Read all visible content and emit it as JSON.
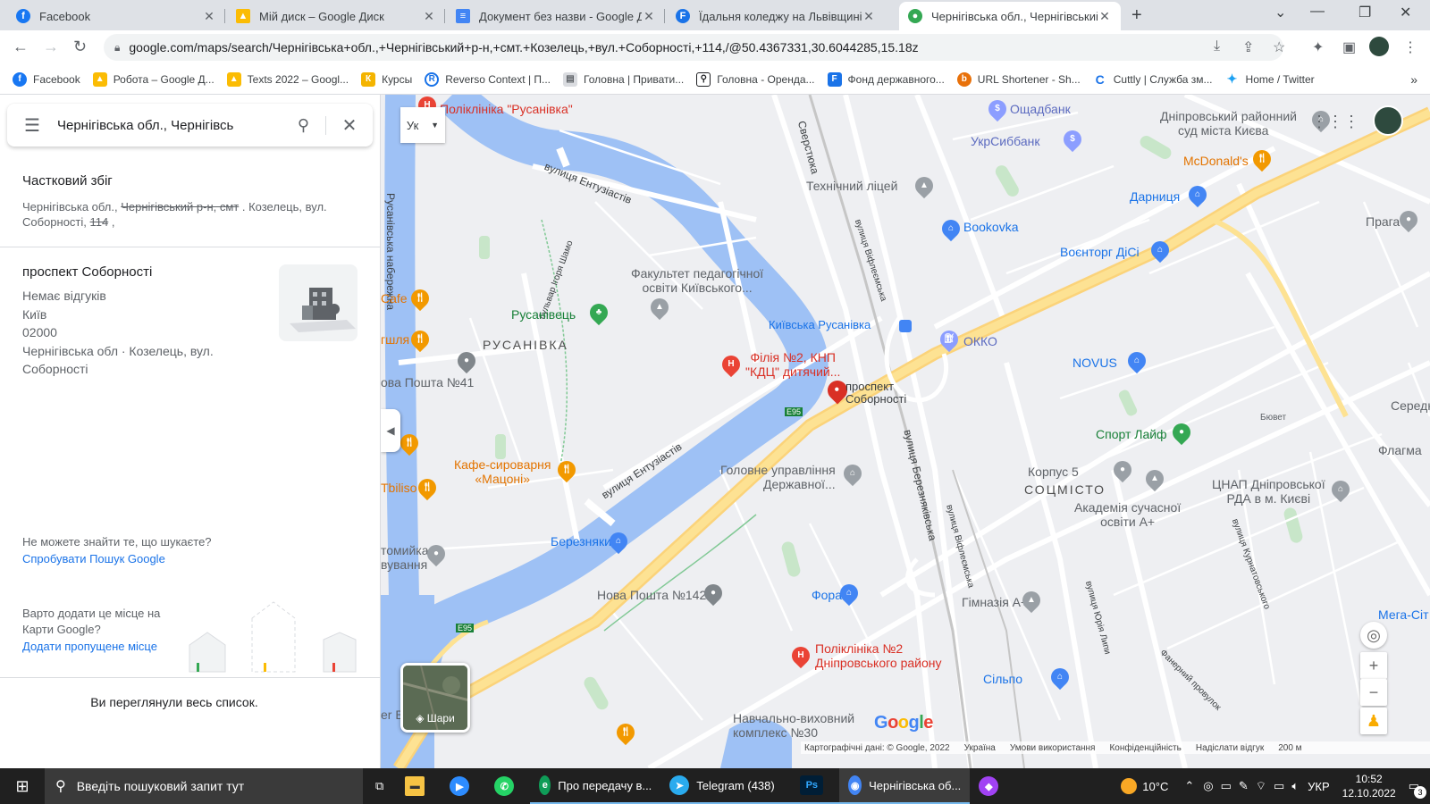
{
  "browser": {
    "tabs": [
      {
        "title": "Facebook",
        "icon": "facebook-icon",
        "color": "#1877f2"
      },
      {
        "title": "Мій диск – Google Диск",
        "icon": "google-drive-icon",
        "color": "#fbbc04"
      },
      {
        "title": "Документ без назви - Google Д",
        "icon": "google-docs-icon",
        "color": "#4285f4"
      },
      {
        "title": "Їдальня коледжу на Львівщині",
        "icon": "fond-icon",
        "color": "#1a73e8"
      },
      {
        "title": "Чернігівська обл., Чернігівський",
        "icon": "google-maps-icon",
        "color": "#34a853"
      }
    ],
    "url": "google.com/maps/search/Чернігівська+обл.,+Чернігівський+р-н,+смт.+Козелець,+вул.+Соборності,+114,/@50.4367331,30.6044285,15.18z",
    "bookmarks": [
      {
        "label": "Facebook",
        "color": "#1877f2"
      },
      {
        "label": "Робота – Google Д...",
        "color": "#fbbc04"
      },
      {
        "label": "Texts 2022 – Googl...",
        "color": "#fbbc04"
      },
      {
        "label": "Курсы",
        "color": "#f4b400"
      },
      {
        "label": "Reverso Context | П...",
        "color": "#1a73e8"
      },
      {
        "label": "Головна | Привати...",
        "color": "#9aa0a6"
      },
      {
        "label": "Головна - Оренда...",
        "color": "#202124"
      },
      {
        "label": "Фонд державного...",
        "color": "#1a73e8"
      },
      {
        "label": "URL Shortener - Sh...",
        "color": "#e8710a"
      },
      {
        "label": "Cuttly | Служба зм...",
        "color": "#1a73e8"
      },
      {
        "label": "Home / Twitter",
        "color": "#1da1f2"
      }
    ]
  },
  "panel": {
    "search_query": "Чернігівська обл., Чернігівсь",
    "partial_title": "Частковий збіг",
    "partial_line1_a": "Чернігівська обл.,",
    "partial_line1_strike": "Чернігівський р-н, смт",
    "partial_line1_b": ". Козелець, вул.",
    "partial_line2_a": "Соборності,",
    "partial_line2_strike": "114",
    "partial_line2_b": ",",
    "result": {
      "name": "проспект Соборності",
      "reviews": "Немає відгуків",
      "city": "Київ",
      "zip": "02000",
      "address1": "Чернігівська обл · Козелець, вул.",
      "address2": "Соборності"
    },
    "cant_find": "Не можете знайти те, що шукаєте?",
    "try_google": "Спробувати Пошук Google",
    "add_question": "Варто додати це місце на Карти Google?",
    "add_link": "Додати пропущене місце",
    "end_of_list": "Ви переглянули весь список."
  },
  "map": {
    "lang_label": "Ук",
    "layers_label": "Шари",
    "google": "Google",
    "labels": {
      "policlinic_rus": "Поліклініка \"Русанівка\"",
      "oshchadbank": "Ощадбанк",
      "ukrsibbank": "УкрСиббанк",
      "court": "Дніпровський районний",
      "court2": "суд міста Києва",
      "mcdonalds": "McDonald's",
      "tech_lyceum": "Технічний ліцей",
      "darnytsia": "Дарниця",
      "praha": "Прага",
      "bookovka": "Bookovka",
      "voentorg": "Воєнторг ДіСі",
      "faculty1": "Факультет педагогічної",
      "faculty2": "освіти Київського...",
      "rusanivets": "Русанівець",
      "cafe": "Cafe",
      "rusanivka": "РУСАНІВКА",
      "kyivska_rus": "Київська Русанівка",
      "okko": "ОККО",
      "novus": "NOVUS",
      "nova41": "ова Пошта №41",
      "filia1": "Філія №2, КНП",
      "filia2": "\"КДЦ\" дитячий...",
      "pr_sob1": "проспект",
      "pr_sob2": "Соборності",
      "sport_life": "Спорт Лайф",
      "seredn": "Середн",
      "flagma": "Флагма",
      "byuvet": "Бювет",
      "cafe_matsoni1": "Кафе-сироварня",
      "cafe_matsoni2": "«Мацоні»",
      "tbilisi": "Tbiliso",
      "glavnoe1": "Головне управління",
      "glavnoe2": "Державної...",
      "korpus5": "Корпус 5",
      "socmisto": "СОЦМІСТО",
      "tsnap1": "ЦНАП Дніпровської",
      "tsnap2": "РДА в м. Києві",
      "academy1": "Академія сучасної",
      "academy2": "освіти А+",
      "bereznyaky": "Березняки",
      "gomiyka1": "томийка",
      "gomiyka2": "вування",
      "nova142": "Нова Пошта №142",
      "fora": "Фора",
      "gymnasia": "Гімназія А+",
      "megacity": "Мега-Сіт",
      "polyclinic2_1": "Поліклініка №2",
      "polyclinic2_2": "Дніпровського району",
      "silpo": "Сільпо",
      "navch1": "Навчально-виховний",
      "navch2": "комплекс №30",
      "ber_b": "er B",
      "rusnab": "Русанівська набережна",
      "entuz1": "вулиця Ентузіастів",
      "entuz2": "вулиця Ентузіастів",
      "shamo": "бульвар Ігоря Шамо",
      "verst": "Сверстюка",
      "vifl1": "вулиця Віфлеємська",
      "vifl2": "вулиця Віфлеємська",
      "berez": "вулиця Березняківська",
      "lypy": "вулиця Юрія Липи",
      "kurn": "вулиця Курнатовського",
      "fanern": "Фанерний провулок",
      "e95a": "E95",
      "e95b": "E95",
      "chygla": "гшля"
    },
    "footer": [
      "Картографічні дані: © Google, 2022",
      "Україна",
      "Умови використання",
      "Конфіденційність",
      "Надіслати відгук",
      "200 м"
    ]
  },
  "taskbar": {
    "search_placeholder": "Введіть пошуковий запит тут",
    "apps": [
      {
        "label": "Про передачу в...",
        "color": "#0f9d58"
      },
      {
        "label": "Telegram (438)",
        "color": "#2aabee"
      },
      {
        "label": "Ps",
        "color": "#31a8ff"
      },
      {
        "label": "Чернігівська об...",
        "color": "#4285f4"
      }
    ],
    "temperature": "10°C",
    "lang": "УКР",
    "time": "10:52",
    "date": "12.10.2022",
    "notif_count": "3"
  }
}
